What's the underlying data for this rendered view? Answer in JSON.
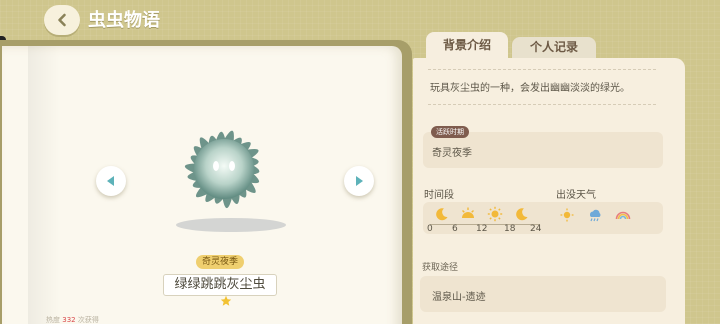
{
  "header": {
    "title": "虫虫物语"
  },
  "tabs": [
    {
      "label": "背景介绍",
      "active": true
    },
    {
      "label": "个人记录",
      "active": false
    }
  ],
  "creature": {
    "name": "绿绿跳跳灰尘虫",
    "season_badge": "奇灵夜季",
    "stars": 1,
    "color": "#8fb3a9",
    "image_icon": "fuzzy-dust-bug"
  },
  "footer": {
    "left": "热度",
    "count": "332",
    "right": "次获得"
  },
  "description": "玩具灰尘虫的一种，会发出幽幽淡淡的绿光。",
  "active_period": {
    "label": "活跃时期",
    "value": "奇灵夜季"
  },
  "time": {
    "title": "时间段",
    "ticks": [
      "0",
      "6",
      "12",
      "18",
      "24"
    ],
    "icons": [
      "moon-icon",
      "sun-icon",
      "sun-icon",
      "moon-icon"
    ]
  },
  "weather": {
    "title": "出没天气",
    "icons": [
      "sunny-icon",
      "rain-icon",
      "rainbow-icon"
    ]
  },
  "method": {
    "title": "获取途径",
    "value": "温泉山-遗迹"
  },
  "colors": {
    "background": "#cfc68d",
    "panel": "#f7efdf",
    "badge": "#efcf6f",
    "active_label": "#7f5c4e",
    "nav_arrow": "#5db2b9"
  }
}
